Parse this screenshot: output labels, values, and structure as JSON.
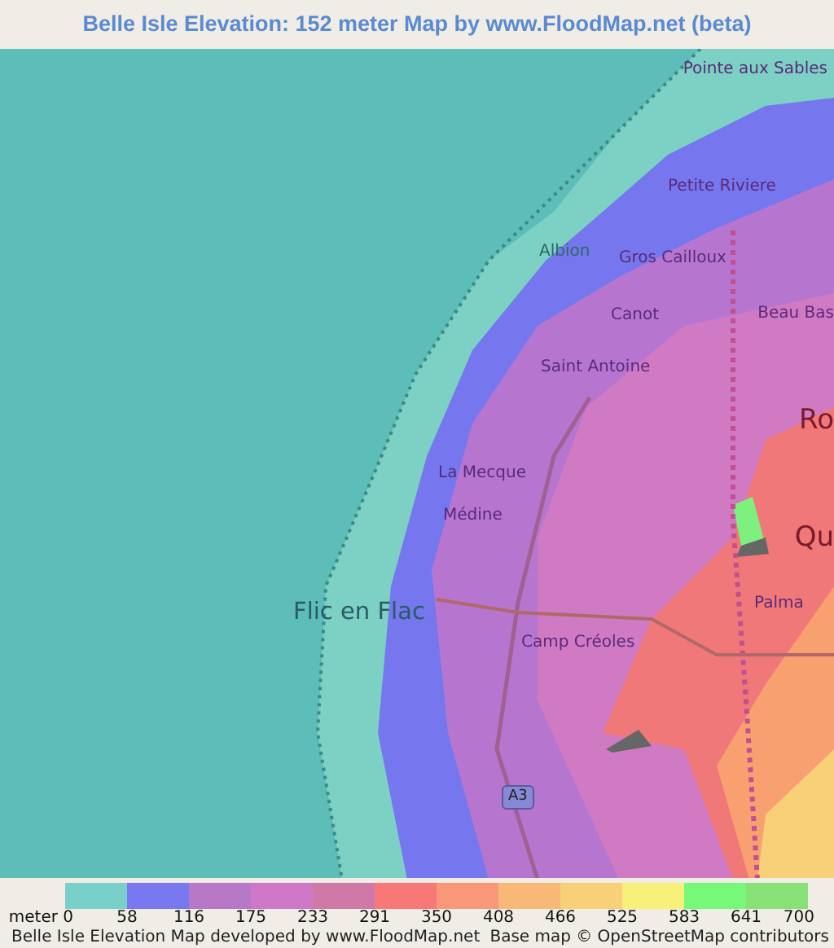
{
  "title": "Belle Isle Elevation: 152 meter Map by www.FloodMap.net (beta)",
  "map": {
    "labels": [
      {
        "text": "Pointe aux Sables",
        "kind": "town"
      },
      {
        "text": "Petite Riviere",
        "kind": "town"
      },
      {
        "text": "Albion",
        "kind": "coast"
      },
      {
        "text": "Gros Cailloux",
        "kind": "town"
      },
      {
        "text": "Canot",
        "kind": "town"
      },
      {
        "text": "Beau Bas",
        "kind": "town"
      },
      {
        "text": "Saint Antoine",
        "kind": "town"
      },
      {
        "text": "Ro",
        "kind": "city"
      },
      {
        "text": "La Mecque",
        "kind": "town"
      },
      {
        "text": "Médine",
        "kind": "town"
      },
      {
        "text": "Qu",
        "kind": "city"
      },
      {
        "text": "Flic en Flac",
        "kind": "coastcity"
      },
      {
        "text": "Palma",
        "kind": "town"
      },
      {
        "text": "Camp Créoles",
        "kind": "town"
      },
      {
        "text": "A3",
        "kind": "road"
      }
    ]
  },
  "legend": {
    "swatches": [
      {
        "color": "#78d0c8"
      },
      {
        "color": "#7878f0"
      },
      {
        "color": "#b878c8"
      },
      {
        "color": "#d078c8"
      },
      {
        "color": "#d078a8"
      },
      {
        "color": "#f87878"
      },
      {
        "color": "#f89878"
      },
      {
        "color": "#f8b878"
      },
      {
        "color": "#f8d078"
      },
      {
        "color": "#f8f078"
      },
      {
        "color": "#78f878"
      },
      {
        "color": "#88e078"
      }
    ],
    "ticks": [
      "meter 0",
      "58",
      "116",
      "175",
      "233",
      "291",
      "350",
      "408",
      "466",
      "525",
      "583",
      "641",
      "700"
    ]
  },
  "footer": {
    "credit": "Belle Isle Elevation Map developed by www.FloodMap.net",
    "attribution": "Base map © OpenStreetMap contributors"
  }
}
